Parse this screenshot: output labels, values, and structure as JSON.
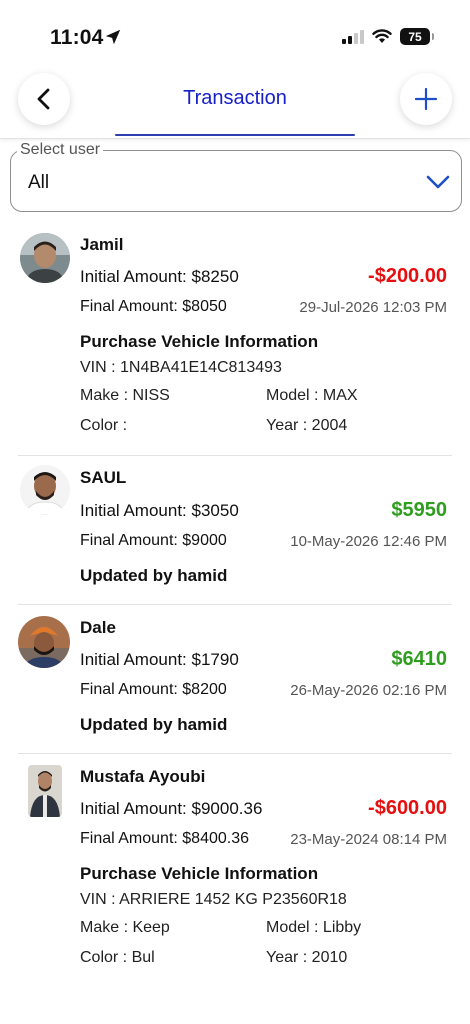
{
  "status_bar": {
    "time": "11:04",
    "battery": "75"
  },
  "header": {
    "title": "Transaction"
  },
  "filter": {
    "label": "Select user",
    "value": "All"
  },
  "transactions": [
    {
      "name": "Jamil",
      "initial_amount": "Initial Amount: $8250",
      "amount": "-$200.00",
      "amount_type": "negative",
      "final_amount": "Final Amount: $8050",
      "date": "29-Jul-2026 12:03 PM",
      "vehicle": {
        "title": "Purchase Vehicle Information",
        "vin": "VIN : 1N4BA41E14C813493",
        "make": "Make : NISS",
        "model": "Model : MAX",
        "color": "Color :",
        "year": "Year : 2004"
      }
    },
    {
      "name": "SAUL",
      "initial_amount": "Initial Amount: $3050",
      "amount": "$5950",
      "amount_type": "positive",
      "final_amount": "Final Amount: $9000",
      "date": "10-May-2026 12:46 PM",
      "updated_by": "Updated by hamid"
    },
    {
      "name": "Dale",
      "initial_amount": "Initial Amount: $1790",
      "amount": "$6410",
      "amount_type": "positive",
      "final_amount": "Final Amount: $8200",
      "date": "26-May-2026 02:16 PM",
      "updated_by": "Updated by hamid"
    },
    {
      "name": "Mustafa Ayoubi",
      "initial_amount": "Initial Amount: $9000.36",
      "amount": "-$600.00",
      "amount_type": "negative",
      "final_amount": "Final Amount: $8400.36",
      "date": "23-May-2024 08:14 PM",
      "vehicle": {
        "title": "Purchase Vehicle Information",
        "vin": "VIN : ARRIERE 1452 KG P23560R18",
        "make": "Make : Keep",
        "model": "Model : Libby",
        "color": "Color : Bul",
        "year": "Year : 2010"
      }
    }
  ],
  "icons": {
    "location": "location-arrow-icon",
    "signal": "cellular-signal-icon",
    "wifi": "wifi-icon",
    "battery": "battery-icon",
    "back": "chevron-left-icon",
    "add": "plus-icon",
    "dropdown": "chevron-down-icon"
  },
  "colors": {
    "title": "#1620c8",
    "negative": "#e60e0e",
    "positive": "#2f9e1e",
    "chevron": "#1e4fc8"
  }
}
